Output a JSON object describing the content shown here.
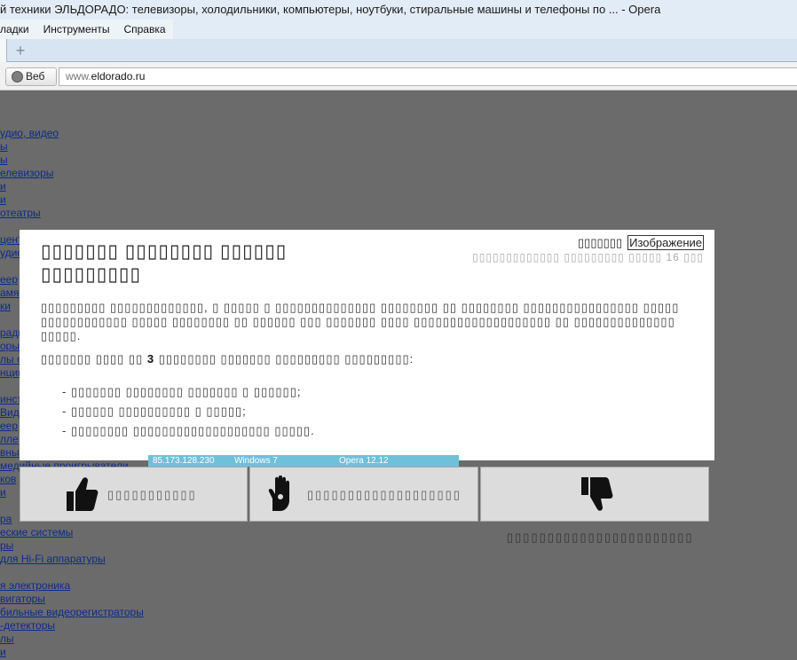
{
  "window": {
    "title": "й техники ЭЛЬДОРАДО: телевизоры, холодильники, компьютеры, ноутбуки, стиральные машины и телефоны по ... - Opera"
  },
  "menu": {
    "items": [
      "ладки",
      "Инструменты",
      "Справка"
    ]
  },
  "toolbar": {
    "new_tab_icon": "plus-icon",
    "web_label": "Веб",
    "address_prefix": "www.",
    "address_domain": "eldorado.ru"
  },
  "links": [
    "удио, видео",
    "ы",
    "ы",
    "елевизоры",
    "и",
    "и",
    "отеатры",
    "цент",
    "удио",
    "еер",
    "амя",
    "ки",
    "ради",
    "оры",
    "лы с",
    "нции",
    "инст",
    "Виде",
    "еер",
    "лле",
    "вны",
    "медийные проигрыватели",
    "ков",
    "и",
    "ра",
    "еские системы",
    "ры",
    "для Hi-Fi аппаратуры",
    "я электроника",
    "вигаторы",
    "бильные видеорегистраторы",
    "-детекторы",
    "лы",
    "и"
  ],
  "modal": {
    "title": "▯▯▯▯▯▯▯ ▯▯▯▯▯▯▯▯ ▯▯▯▯▯▯ ▯▯▯▯▯▯▯▯▯",
    "switch_label": "▯▯▯▯▯▯▯",
    "image_toggle": "Изображение",
    "meta_prefix": "▯▯▯▯▯▯▯▯▯▯▯▯▯ ▯▯▯▯▯▯▯▯▯ ▯▯▯▯▯",
    "meta_number": "16",
    "meta_suffix": "▯▯▯",
    "paragraph": "▯▯▯▯▯▯▯▯▯ ▯▯▯▯▯▯▯▯▯▯▯▯▯, ▯ ▯▯▯▯▯ ▯ ▯▯▯▯▯▯▯▯▯▯▯▯▯▯ ▯▯▯▯▯▯▯▯ ▯▯ ▯▯▯▯▯▯▯▯ ▯▯▯▯▯▯▯▯▯▯▯▯▯▯▯▯ ▯▯▯▯▯ ▯▯▯▯▯▯▯▯▯▯▯▯ ▯▯▯▯▯ ▯▯▯▯▯▯▯▯ ▯▯ ▯▯▯▯▯▯ ▯▯▯ ▯▯▯▯▯▯▯ ▯▯▯▯ ▯▯▯▯▯▯▯▯▯▯▯▯▯▯▯▯▯▯▯ ▯▯ ▯▯▯▯▯▯▯▯▯▯▯▯▯▯ ▯▯▯▯▯.",
    "line2_prefix": "▯▯▯▯▯▯▯ ▯▯▯▯ ▯▯",
    "line2_number": "3",
    "line2_suffix": "▯▯▯▯▯▯▯▯ ▯▯▯▯▯▯▯ ▯▯▯▯▯▯▯▯▯ ▯▯▯▯▯▯▯▯▯:",
    "list": [
      "- ▯▯▯▯▯▯▯ ▯▯▯▯▯▯▯▯ ▯▯▯▯▯▯▯ ▯ ▯▯▯▯▯▯;",
      "- ▯▯▯▯▯▯ ▯▯▯▯▯▯▯▯▯▯ ▯ ▯▯▯▯▯;",
      "- ▯▯▯▯▯▯▯▯ ▯▯▯▯▯▯▯▯▯▯▯▯▯▯▯▯▯▯▯ ▯▯▯▯▯."
    ]
  },
  "infobar": {
    "ip": "85.173.128.230",
    "os": "Windows 7",
    "browser": "Opera 12.12"
  },
  "votes": [
    {
      "icon": "thumbs-up-icon",
      "label": "▯▯▯▯▯▯▯▯▯▯▯"
    },
    {
      "icon": "ok-hand-icon",
      "label": "▯▯▯▯▯▯▯▯▯▯▯▯▯▯▯▯▯▯▯"
    },
    {
      "icon": "thumbs-down-icon",
      "label": ""
    }
  ],
  "below_text": "▯▯▯▯▯▯▯▯▯▯▯▯▯▯▯▯▯▯▯▯▯▯▯"
}
